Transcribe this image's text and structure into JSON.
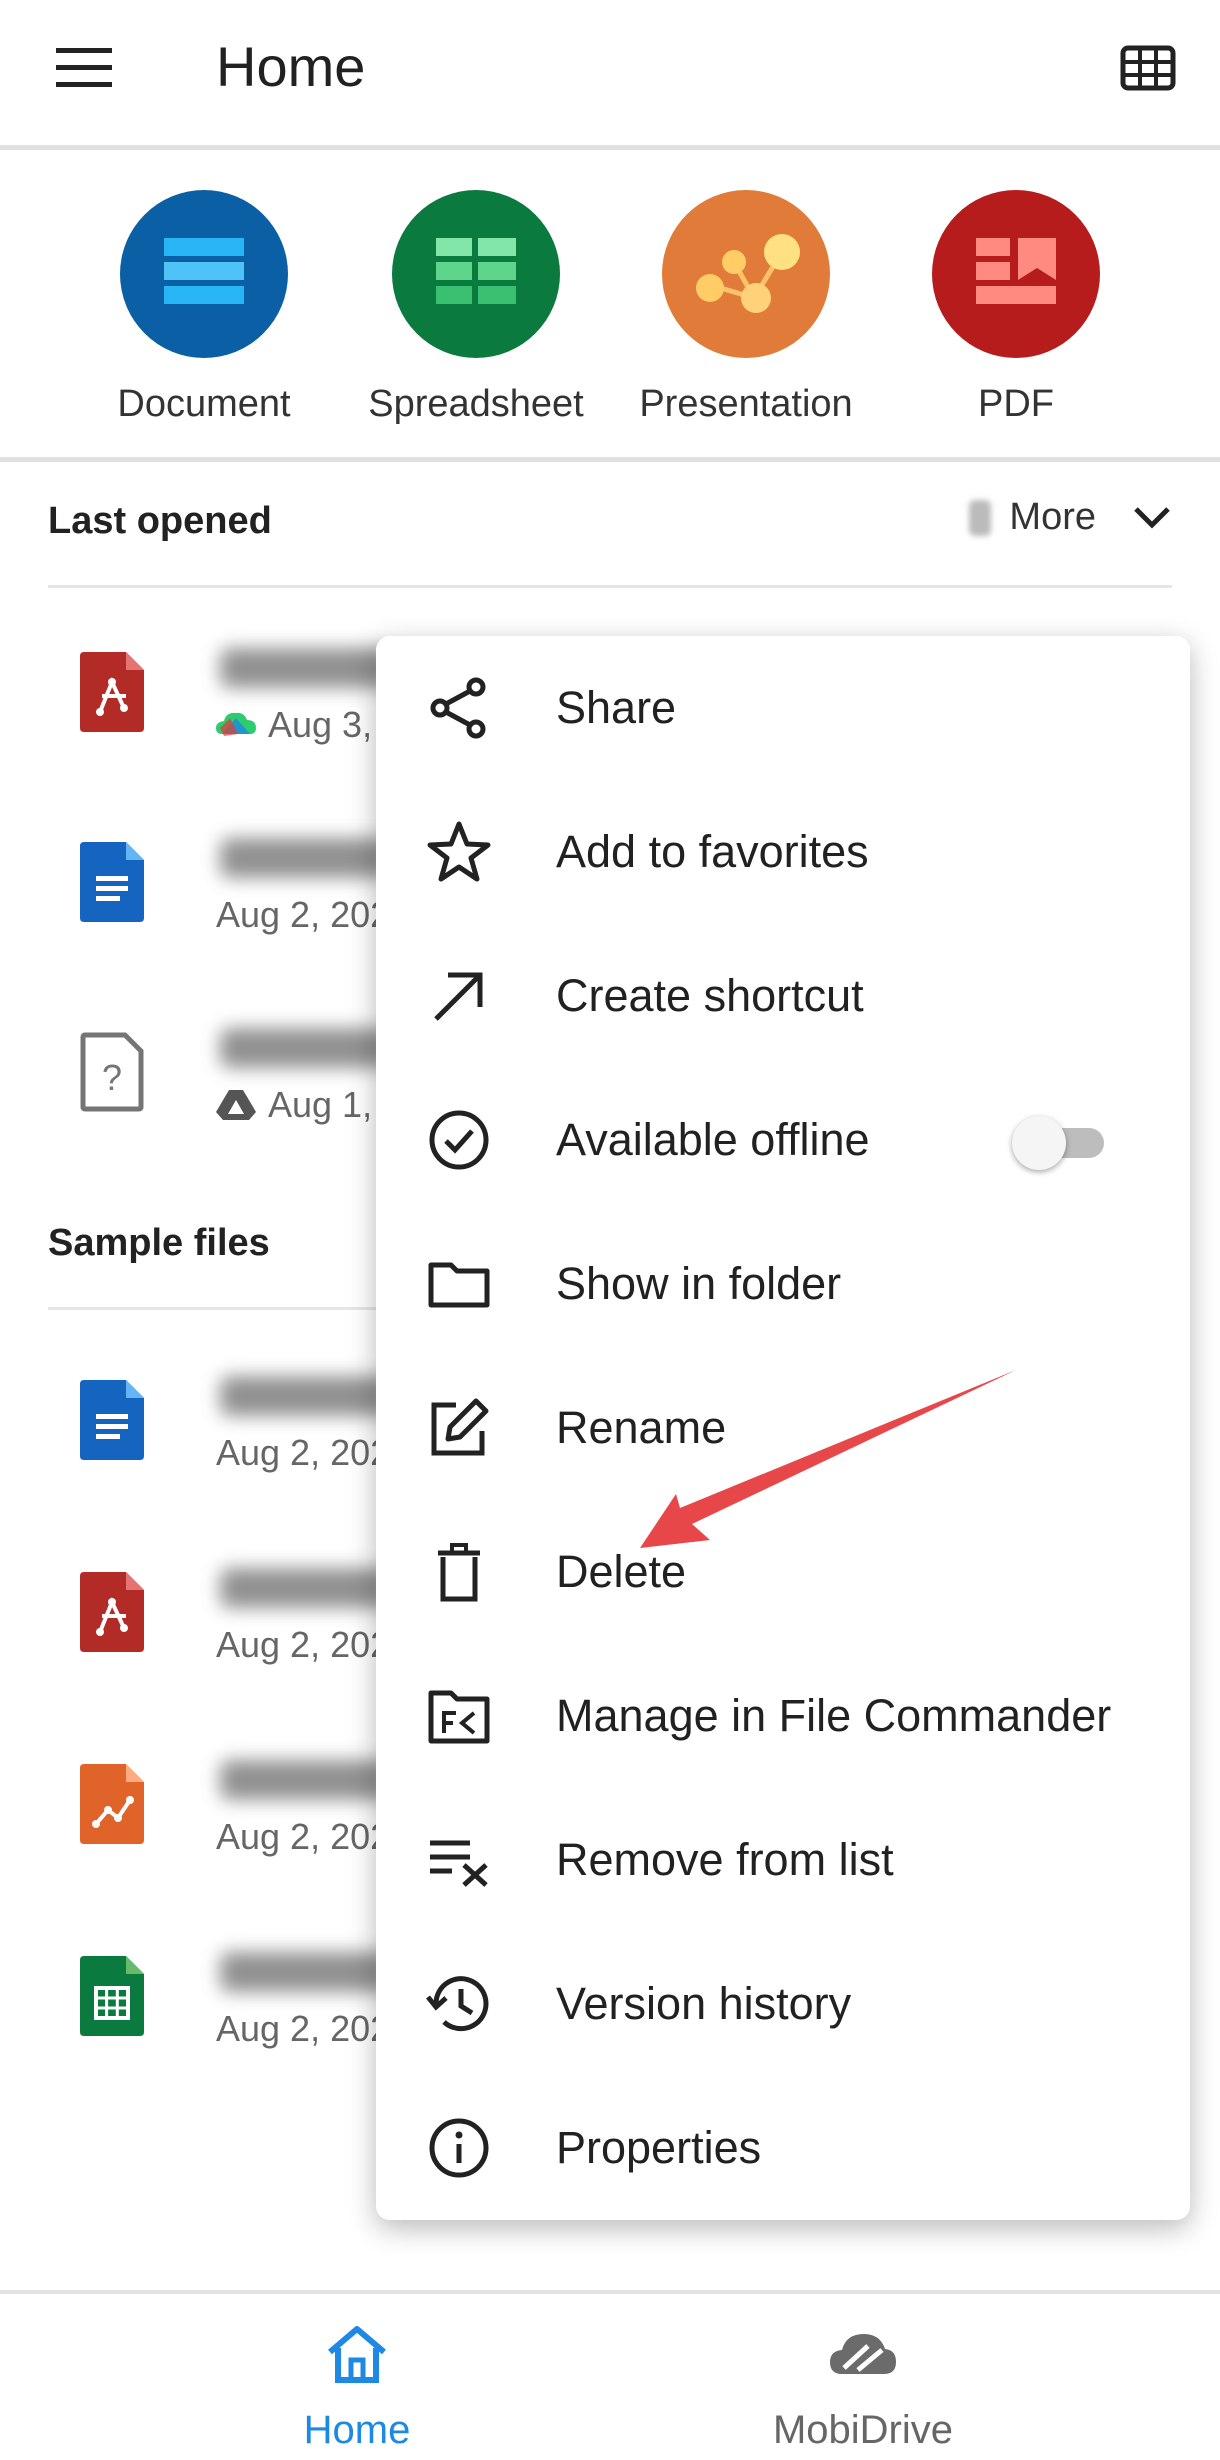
{
  "header": {
    "title": "Home",
    "menu_icon": "hamburger-menu-icon",
    "view_icon": "grid-view-icon"
  },
  "create": {
    "items": [
      {
        "label": "Document",
        "color": "#0b5fa5",
        "icon": "document-icon"
      },
      {
        "label": "Spreadsheet",
        "color": "#0b7a3e",
        "icon": "spreadsheet-icon"
      },
      {
        "label": "Presentation",
        "color": "#e07b39",
        "icon": "presentation-icon"
      },
      {
        "label": "PDF",
        "color": "#b71c1c",
        "icon": "pdf-icon"
      }
    ]
  },
  "last_opened": {
    "title": "Last opened",
    "more_label": "More",
    "files": [
      {
        "type": "pdf",
        "meta": "Aug 3, "
      },
      {
        "type": "doc",
        "meta": "Aug 2, 202"
      },
      {
        "type": "unknown",
        "meta": "Aug 1, "
      }
    ]
  },
  "sample_files": {
    "title": "Sample files",
    "files": [
      {
        "type": "doc",
        "meta": "Aug 2, 202"
      },
      {
        "type": "pdf",
        "meta": "Aug 2, 202"
      },
      {
        "type": "presentation",
        "meta": "Aug 2, 202"
      },
      {
        "type": "spreadsheet",
        "meta": "Aug 2, 202"
      }
    ]
  },
  "context_menu": {
    "items": [
      {
        "label": "Share",
        "icon": "share-icon"
      },
      {
        "label": "Add to favorites",
        "icon": "star-icon"
      },
      {
        "label": "Create shortcut",
        "icon": "arrow-up-right-icon"
      },
      {
        "label": "Available offline",
        "icon": "check-circle-icon",
        "toggle": false
      },
      {
        "label": "Show in folder",
        "icon": "folder-icon"
      },
      {
        "label": "Rename",
        "icon": "edit-icon"
      },
      {
        "label": "Delete",
        "icon": "trash-icon"
      },
      {
        "label": "Manage in File Commander",
        "icon": "file-commander-icon"
      },
      {
        "label": "Remove from list",
        "icon": "remove-list-icon"
      },
      {
        "label": "Version history",
        "icon": "history-icon"
      },
      {
        "label": "Properties",
        "icon": "info-icon"
      }
    ]
  },
  "bottom_nav": {
    "home_label": "Home",
    "mobidrive_label": "MobiDrive",
    "active_color": "#1e88e5"
  },
  "colors": {
    "annotation_arrow": "#e8474a"
  }
}
